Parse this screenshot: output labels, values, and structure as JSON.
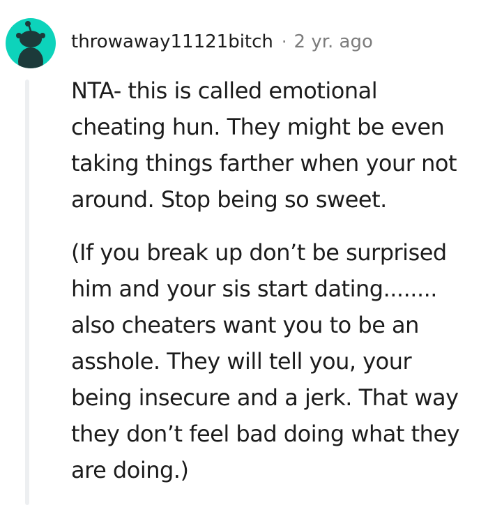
{
  "comment": {
    "author": "throwaway11121bitch",
    "separator": "·",
    "timestamp": "2 yr. ago",
    "paragraphs": [
      "NTA- this is called emotional\ncheating hun. They might be even\ntaking things farther when your not\naround. Stop being so sweet.",
      "(If you break up don’t be surprised\nhim and your sis start dating........\nalso cheaters want you to be an\nasshole. They will tell you, your\nbeing insecure and a jerk. That way\nthey don’t feel bad doing what they\nare doing.)"
    ]
  },
  "avatar": {
    "icon": "snoo-avatar-icon",
    "background": "#0dd3bb",
    "figure_color": "#1c3a3a"
  },
  "colors": {
    "text": "#1c1c1c",
    "meta": "#7c7c7c",
    "thread_line": "#edeff1"
  }
}
